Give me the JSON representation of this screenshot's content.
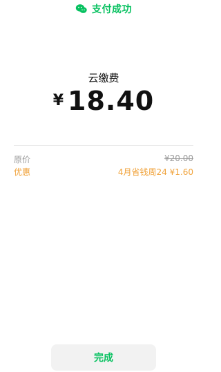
{
  "header": {
    "title": "支付成功",
    "icon": "wechat-pay-icon"
  },
  "merchant": {
    "name": "云缴费"
  },
  "amount": {
    "currency": "¥",
    "value": "18.40"
  },
  "details": {
    "original_label": "原价",
    "original_value": "¥20.00",
    "discount_label": "优惠",
    "discount_value": "4月省钱周24 ¥1.60"
  },
  "actions": {
    "done_label": "完成"
  },
  "colors": {
    "accent": "#07C160",
    "discount": "#F0A23A",
    "muted": "#9B9B9B"
  }
}
